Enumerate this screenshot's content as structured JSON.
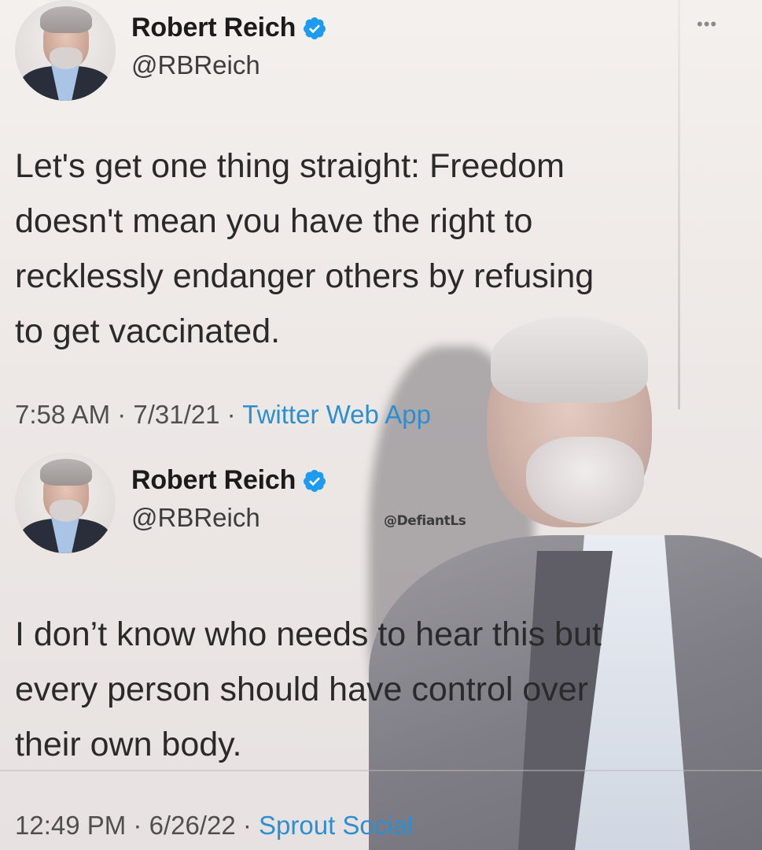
{
  "tweets": [
    {
      "display_name": "Robert Reich",
      "handle": "@RBReich",
      "text": "Let's get one thing straight: Freedom\ndoesn't mean you have the right to\nrecklessly endanger others by refusing\nto get vaccinated.",
      "time": "7:58 AM",
      "date": "7/31/21",
      "source": "Twitter Web App",
      "verified": true
    },
    {
      "display_name": "Robert Reich",
      "handle": "@RBReich",
      "text": "I don’t know who needs to hear this but\nevery person should have control over\ntheir own body.",
      "time": "12:49 PM",
      "date": "6/26/22",
      "source": "Sprout Social",
      "verified": true
    }
  ],
  "watermark": "@DefiantLs",
  "more_glyph": "•••",
  "separator": " · ",
  "colors": {
    "verified_blue": "#1d9bf0",
    "source_link": "#2d8fd0",
    "text": "#2a2a2a"
  },
  "icons": {
    "verified": "verified-badge-icon",
    "more": "more-options-icon"
  }
}
